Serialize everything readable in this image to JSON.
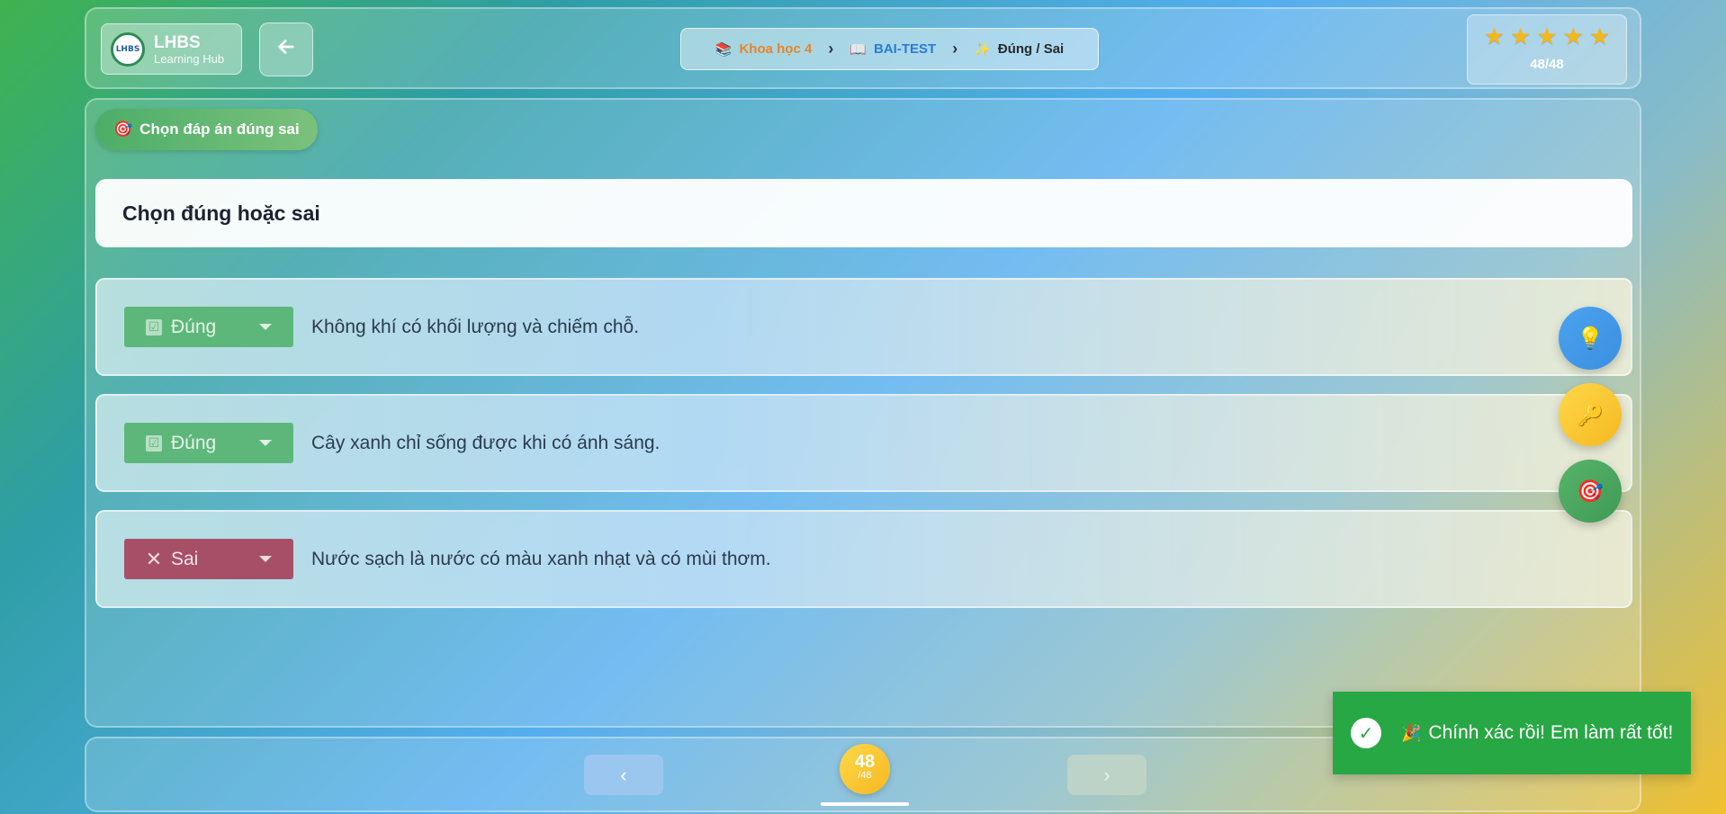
{
  "header": {
    "logo": {
      "badge": "LHBS",
      "title": "LHBS",
      "subtitle": "Learning Hub"
    },
    "back_icon": "arrow-left-icon",
    "breadcrumb": [
      {
        "icon": "📚",
        "label": "Khoa học 4"
      },
      {
        "icon": "📖",
        "label": "BAI-TEST"
      },
      {
        "icon": "✨",
        "label": "Đúng / Sai"
      }
    ],
    "separator": "›",
    "stars": {
      "count": 5,
      "filled": 5,
      "glyph": "★",
      "label": "48/48"
    }
  },
  "main": {
    "mode_chip": {
      "icon": "🎯",
      "label": "Chọn đáp án đúng sai"
    },
    "question_title": "Chọn đúng hoặc sai",
    "items": [
      {
        "answer": "Đúng",
        "answer_type": "true",
        "icon": "☑",
        "text": "Không khí có khối lượng và chiếm chỗ."
      },
      {
        "answer": "Đúng",
        "answer_type": "true",
        "icon": "☑",
        "text": "Cây xanh chỉ sống được khi có ánh sáng."
      },
      {
        "answer": "Sai",
        "answer_type": "false",
        "icon": "✕",
        "text": "Nước sạch là nước có màu xanh nhạt và có mùi thơm."
      }
    ],
    "fabs": [
      {
        "name": "hint",
        "icon": "💡"
      },
      {
        "name": "key",
        "icon": "🔑"
      },
      {
        "name": "target",
        "icon": "🎯"
      }
    ]
  },
  "footer": {
    "prev": "‹",
    "next": "›",
    "page_current": "48",
    "page_total": "/48",
    "progress_fraction": 1.0
  },
  "toast": {
    "check": "✓",
    "icon": "🎉",
    "message": "Chính xác rồi! Em làm rất tốt!"
  },
  "colors": {
    "true": "#5db77a",
    "false": "#a84f68",
    "toast": "#28a745",
    "accent": "#f5b820"
  }
}
